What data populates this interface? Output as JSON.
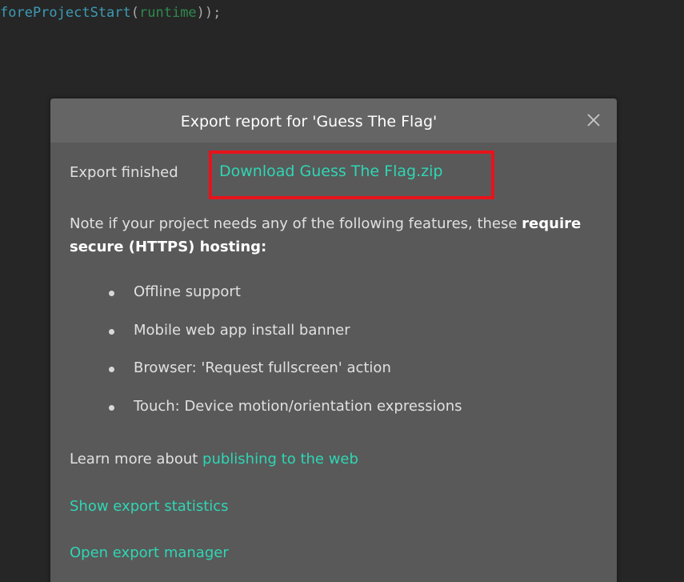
{
  "code": {
    "fn_text": "foreProjectStart",
    "open_paren": "(",
    "arg_text": "runtime",
    "close_text": "));"
  },
  "dialog": {
    "title": "Export report for 'Guess The Flag'",
    "close_icon": "close-icon",
    "export_status": "Export finished",
    "download_link": "Download Guess The Flag.zip",
    "note_prefix": "Note if your project needs any of the following features, these ",
    "note_bold": "require secure (HTTPS) hosting:",
    "features": [
      "Offline support",
      "Mobile web app install banner",
      "Browser: 'Request fullscreen' action",
      "Touch: Device motion/orientation expressions"
    ],
    "learn_more_prefix": "Learn more about ",
    "learn_more_link": "publishing to the web",
    "show_stats_link": "Show export statistics",
    "export_manager_link": "Open export manager"
  },
  "colors": {
    "link": "#2fd6b4",
    "highlight": "#e8121b",
    "dialog_bg": "#595959",
    "header_bg": "#656565"
  }
}
